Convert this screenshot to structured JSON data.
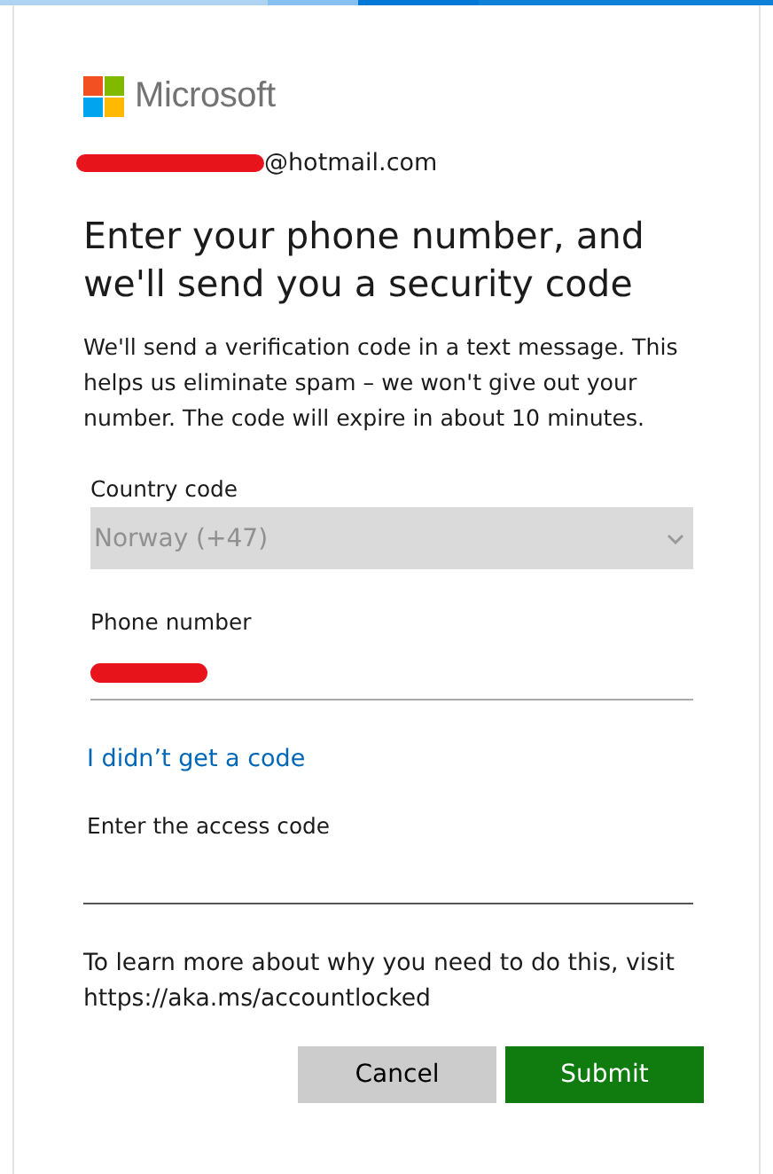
{
  "brand": {
    "name": "Microsoft"
  },
  "account": {
    "email_suffix": "@hotmail.com",
    "redacted": true
  },
  "heading": "Enter your phone number, and we'll send you a security code",
  "description": "We'll send a verification code in a text message. This helps us eliminate spam – we won't give out your number. The code will expire in about 10 minutes.",
  "fields": [
    {
      "kind": "select",
      "label": "Country code",
      "value": "Norway (+47)",
      "disabled": true
    },
    {
      "kind": "text",
      "label": "Phone number",
      "redacted": true
    },
    {
      "kind": "link",
      "label": "I didn’t get a code"
    },
    {
      "kind": "text",
      "label": "Enter the access code",
      "redacted": false
    }
  ],
  "info": "To learn more about why you need to do this, visit https://aka.ms/accountlocked",
  "buttons": [
    {
      "label": "Cancel",
      "kind": "secondary"
    },
    {
      "label": "Submit",
      "kind": "primary"
    }
  ]
}
